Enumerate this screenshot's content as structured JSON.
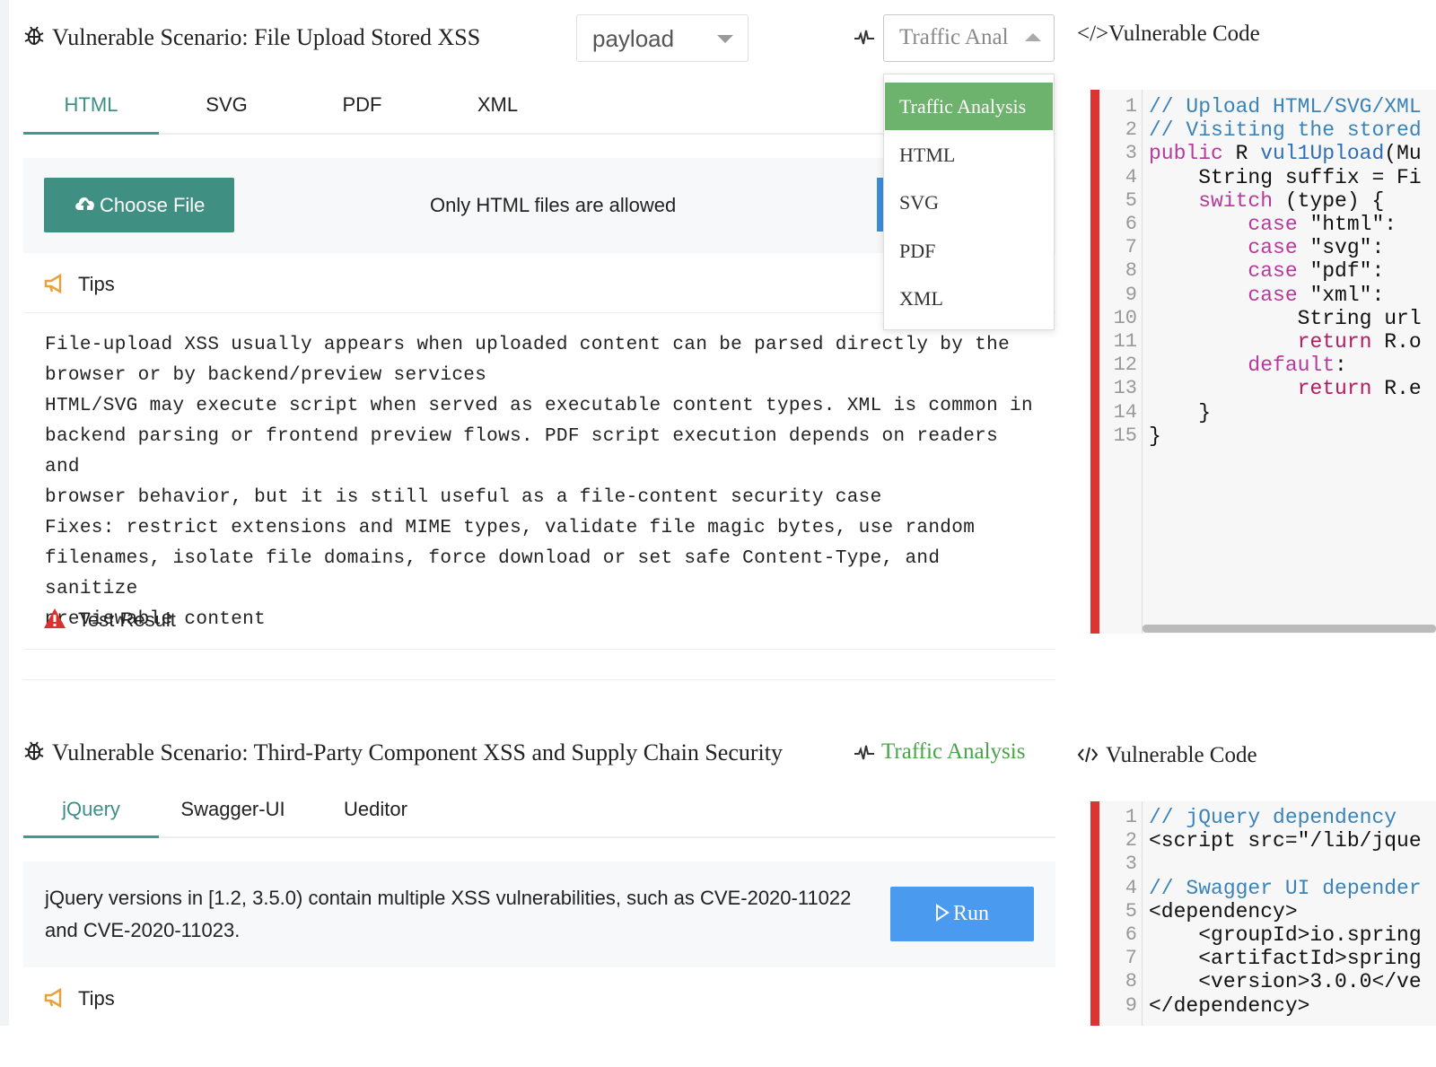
{
  "scenario1": {
    "title": "Vulnerable Scenario: File Upload Stored XSS",
    "payload_select": {
      "value": "payload"
    },
    "traffic_select": {
      "value": "Traffic Anal",
      "options": [
        "Traffic Analysis",
        "HTML",
        "SVG",
        "PDF",
        "XML"
      ],
      "selected": "Traffic Analysis"
    },
    "tabs": [
      "HTML",
      "SVG",
      "PDF",
      "XML"
    ],
    "active_tab": "HTML",
    "choose_file_label": "Choose File",
    "upload_hint": "Only HTML files are allowed",
    "tips_label": "Tips",
    "tips_text": "File-upload XSS usually appears when uploaded content can be parsed directly by the\nbrowser or by backend/preview services\nHTML/SVG may execute script when served as executable content types. XML is common in\nbackend parsing or frontend preview flows. PDF script execution depends on readers and\nbrowser behavior, but it is still useful as a file-content security case\nFixes: restrict extensions and MIME types, validate file magic bytes, use random\nfilenames, isolate file domains, force download or set safe Content-Type, and sanitize\npreviewable content",
    "test_result_label": "Test Result",
    "code_title": "</>Vulnerable Code",
    "code_lines": [
      "// Upload HTML/SVG/XML",
      "// Visiting the stored",
      "public R vul1Upload(Mu",
      "    String suffix = Fi",
      "    switch (type) {",
      "        case \"html\":",
      "        case \"svg\":",
      "        case \"pdf\":",
      "        case \"xml\":",
      "            String url",
      "            return R.o",
      "        default:",
      "            return R.e",
      "    }",
      "}"
    ]
  },
  "scenario2": {
    "title": "Vulnerable Scenario: Third-Party Component XSS and Supply Chain Security",
    "traffic_link": "Traffic Analysis",
    "tabs": [
      "jQuery",
      "Swagger-UI",
      "Ueditor"
    ],
    "active_tab": "jQuery",
    "description_line1": "jQuery versions in [1.2, 3.5.0) contain multiple XSS vulnerabilities, such as CVE-2020-11022",
    "description_line2": "and CVE-2020-11023.",
    "run_label": "Run",
    "tips_label": "Tips",
    "code_title": "Vulnerable Code",
    "code_lines": [
      "// jQuery dependency",
      "<script src=\"/lib/jque",
      "",
      "// Swagger UI depender",
      "<dependency>",
      "    <groupId>io.spring",
      "    <artifactId>spring",
      "    <version>3.0.0</ve",
      "</dependency>"
    ]
  },
  "icons": [
    "bug-icon",
    "pulse-icon",
    "cloud-upload-icon",
    "megaphone-icon",
    "warning-icon",
    "code-icon",
    "play-icon"
  ],
  "colors": {
    "accent_green": "#3c8f86",
    "menu_selected": "#6db26d",
    "run_blue": "#4a9af0",
    "code_bar_red": "#dd3333"
  }
}
